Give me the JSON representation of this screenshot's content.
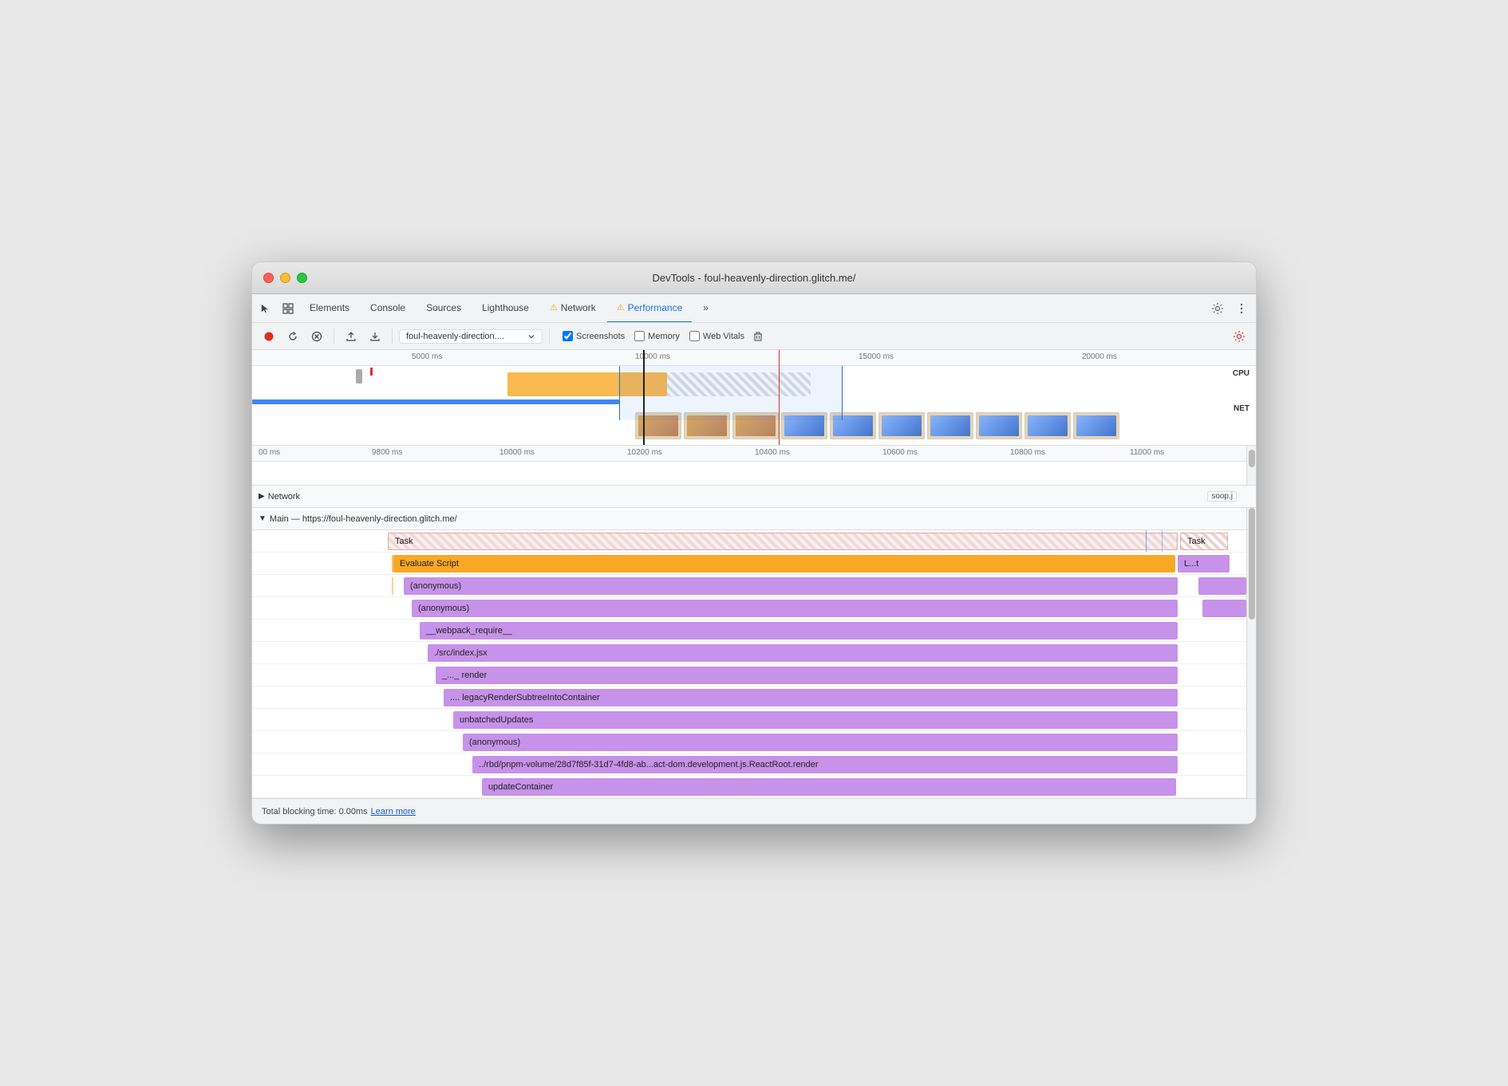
{
  "window": {
    "title": "DevTools - foul-heavenly-direction.glitch.me/"
  },
  "toolbar": {
    "tabs": [
      {
        "id": "elements",
        "label": "Elements",
        "active": false,
        "warn": false
      },
      {
        "id": "console",
        "label": "Console",
        "active": false,
        "warn": false
      },
      {
        "id": "sources",
        "label": "Sources",
        "active": false,
        "warn": false
      },
      {
        "id": "lighthouse",
        "label": "Lighthouse",
        "active": false,
        "warn": false
      },
      {
        "id": "network",
        "label": "Network",
        "active": false,
        "warn": true
      },
      {
        "id": "performance",
        "label": "Performance",
        "active": true,
        "warn": true
      },
      {
        "id": "more",
        "label": "»",
        "active": false,
        "warn": false
      }
    ]
  },
  "toolbar2": {
    "url_value": "foul-heavenly-direction....",
    "screenshots_label": "Screenshots",
    "memory_label": "Memory",
    "webvitals_label": "Web Vitals"
  },
  "timeline": {
    "ruler_ticks": [
      "5000 ms",
      "10000 ms",
      "15000 ms",
      "20000 ms"
    ],
    "cpu_label": "CPU",
    "net_label": "NET"
  },
  "zoom_ruler": {
    "ticks": [
      "00 ms",
      "9800 ms",
      "10000 ms",
      "10200 ms",
      "10400 ms",
      "10600 ms",
      "10800 ms",
      "11000 ms"
    ]
  },
  "network_section": {
    "label": "Network",
    "badge": "soop.j"
  },
  "main_section": {
    "header": "Main — https://foul-heavenly-direction.glitch.me/",
    "rows": [
      {
        "indent": 0,
        "label": "Task",
        "bar_type": "task",
        "right_label": "Task"
      },
      {
        "indent": 1,
        "label": "Evaluate Script",
        "bar_type": "evaluate",
        "right_label": "L...t"
      },
      {
        "indent": 2,
        "label": "(anonymous)",
        "bar_type": "purple"
      },
      {
        "indent": 3,
        "label": "(anonymous)",
        "bar_type": "purple"
      },
      {
        "indent": 4,
        "label": "__webpack_require__",
        "bar_type": "purple"
      },
      {
        "indent": 5,
        "label": "./src/index.jsx",
        "bar_type": "purple"
      },
      {
        "indent": 6,
        "label": "_..._ render",
        "bar_type": "purple"
      },
      {
        "indent": 7,
        "label": ".... legacyRenderSubtreeIntoContainer",
        "bar_type": "purple"
      },
      {
        "indent": 8,
        "label": "unbatchedUpdates",
        "bar_type": "purple"
      },
      {
        "indent": 9,
        "label": "(anonymous)",
        "bar_type": "purple"
      },
      {
        "indent": 10,
        "label": "../rbd/pnpm-volume/28d7f85f-31d7-4fd8-ab...act-dom.development.js.ReactRoot.render",
        "bar_type": "purple"
      },
      {
        "indent": 11,
        "label": "updateContainer",
        "bar_type": "purple"
      }
    ]
  },
  "status_bar": {
    "text": "Total blocking time: 0.00ms",
    "learn_more": "Learn more"
  },
  "colors": {
    "accent_blue": "#1a73e8",
    "accent_red": "#d93025",
    "warning_yellow": "#f9a825",
    "purple": "#c792e9",
    "purple_light": "#d9b3f0"
  }
}
